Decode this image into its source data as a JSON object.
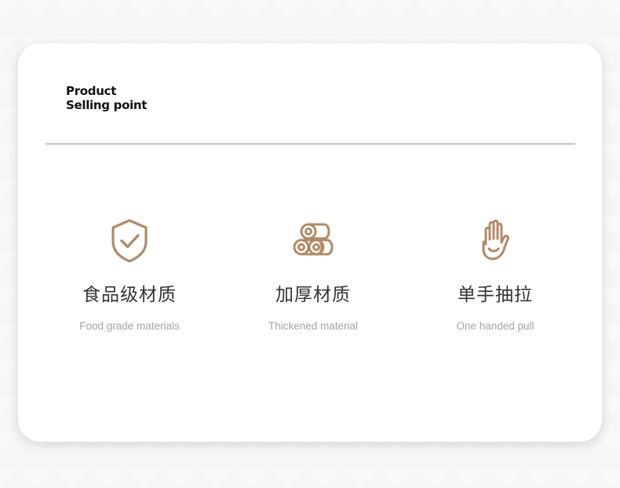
{
  "heading": {
    "line1": "Product",
    "line2": "Selling point"
  },
  "accent_color": "#b08a66",
  "features": [
    {
      "icon": "shield-check-icon",
      "title": "食品级材质",
      "subtitle": "Food grade materials"
    },
    {
      "icon": "rolls-icon",
      "title": "加厚材质",
      "subtitle": "Thickened material"
    },
    {
      "icon": "hand-icon",
      "title": "单手抽拉",
      "subtitle": "One handed pull"
    }
  ]
}
